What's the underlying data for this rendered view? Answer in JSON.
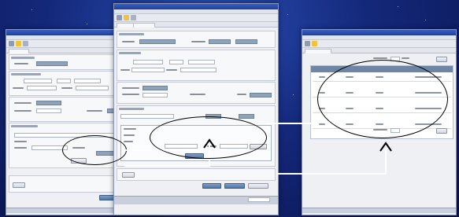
{
  "windows": {
    "left": {
      "title": "",
      "tab_label": ""
    },
    "center": {
      "title": "",
      "tab_label": ""
    },
    "right": {
      "title": "",
      "tab_label": ""
    }
  },
  "accent_colors": {
    "desktop": "#14287a",
    "titlebar": "#1f3f98",
    "connector": "#ffffff",
    "highlight_ellipse": "#000000"
  },
  "icons": [
    "folder-icon",
    "star-icon",
    "arrow-up-icon"
  ]
}
